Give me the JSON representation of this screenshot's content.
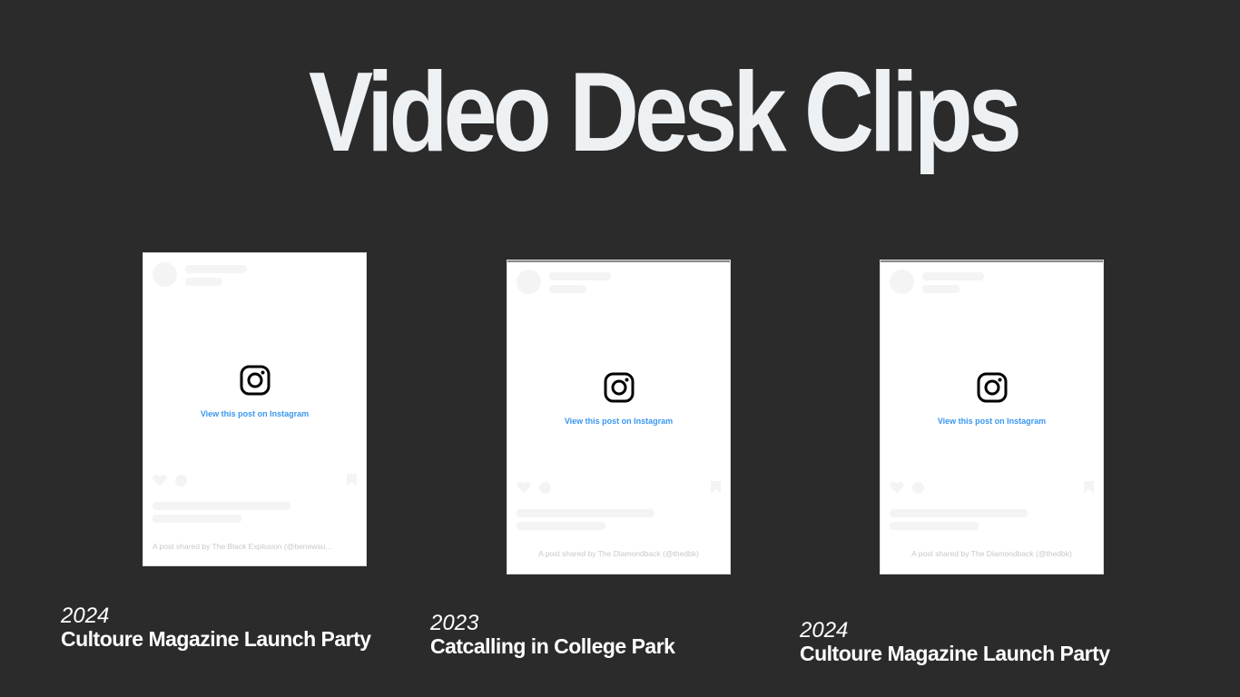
{
  "title": "Video Desk Clips",
  "clips": [
    {
      "year": "2024",
      "name": "Cultoure Magazine Launch Party",
      "embed": {
        "link_text": "View this post on Instagram",
        "footer": "A post shared by The Black Explosion (@benewsu…"
      }
    },
    {
      "year": "2023",
      "name": "Catcalling in College Park",
      "embed": {
        "link_text": "View this post on Instagram",
        "footer": "A post shared by The Diamondback (@thedbk)"
      }
    },
    {
      "year": "2024",
      "name": "Cultoure Magazine Launch Party",
      "embed": {
        "link_text": "View this post on Instagram",
        "footer": "A post shared by The Diamondback (@thedbk)"
      }
    }
  ],
  "icons": {
    "logo": "instagram-icon",
    "like": "heart-icon",
    "comment": "comment-icon",
    "save": "bookmark-icon"
  },
  "colors": {
    "background": "#2b2b2b",
    "title": "#edf1f4",
    "link": "#3897f0",
    "placeholder": "#f4f4f4"
  }
}
